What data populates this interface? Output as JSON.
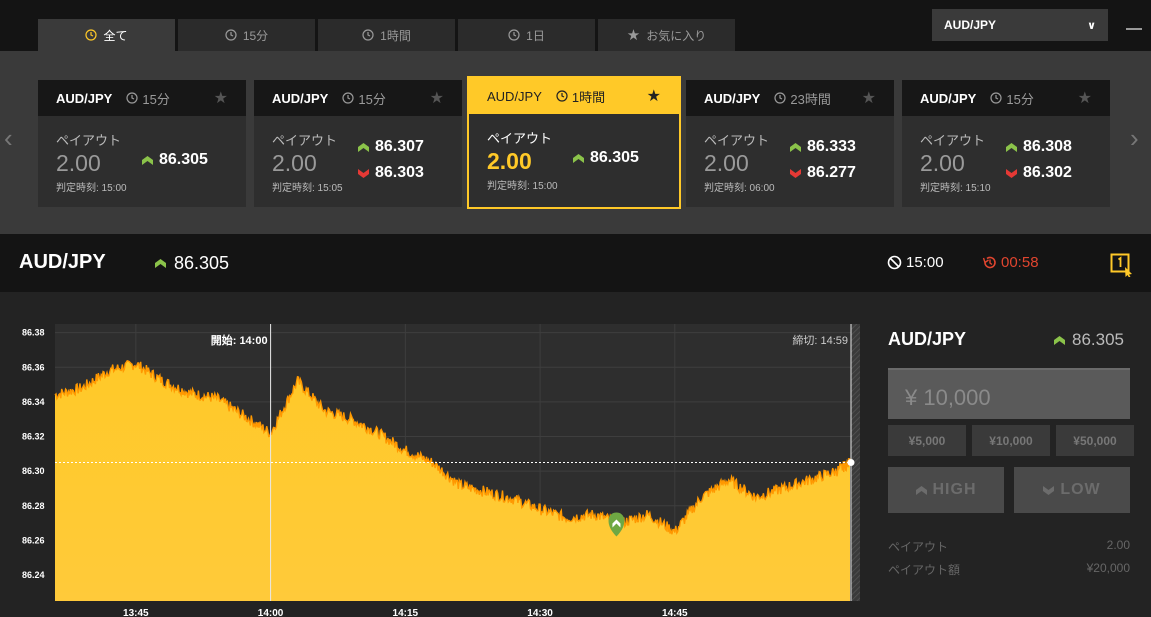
{
  "tabs": [
    {
      "label": "全て",
      "active": true
    },
    {
      "label": "15分",
      "active": false
    },
    {
      "label": "1時間",
      "active": false
    },
    {
      "label": "1日",
      "active": false
    },
    {
      "label": "お気に入り",
      "active": false,
      "icon": "star-icon"
    }
  ],
  "pair_select": {
    "value": "AUD/JPY"
  },
  "cards": [
    {
      "symbol": "AUD/JPY",
      "period": "15分",
      "payout_label": "ペイアウト",
      "payout": "2.00",
      "up": "86.305",
      "down": null,
      "judge": "判定時刻: 15:00",
      "selected": false
    },
    {
      "symbol": "AUD/JPY",
      "period": "15分",
      "payout_label": "ペイアウト",
      "payout": "2.00",
      "up": "86.307",
      "down": "86.303",
      "judge": "判定時刻: 15:05",
      "selected": false
    },
    {
      "symbol": "AUD/JPY",
      "period": "1時間",
      "payout_label": "ペイアウト",
      "payout": "2.00",
      "up": "86.305",
      "down": null,
      "judge": "判定時刻: 15:00",
      "selected": true
    },
    {
      "symbol": "AUD/JPY",
      "period": "23時間",
      "payout_label": "ペイアウト",
      "payout": "2.00",
      "up": "86.333",
      "down": "86.277",
      "judge": "判定時刻: 06:00",
      "selected": false
    },
    {
      "symbol": "AUD/JPY",
      "period": "15分",
      "payout_label": "ペイアウト",
      "payout": "2.00",
      "up": "86.308",
      "down": "86.302",
      "judge": "判定時刻: 15:10",
      "selected": false
    }
  ],
  "symbar": {
    "symbol": "AUD/JPY",
    "rate": "86.305",
    "close_time": "15:00",
    "countdown": "00:58"
  },
  "chart": {
    "start_label": "開始: 14:00",
    "end_label": "締切: 14:59",
    "y_ticks": [
      "86.38",
      "86.36",
      "86.34",
      "86.32",
      "86.30",
      "86.28",
      "86.26",
      "86.24"
    ],
    "x_ticks": [
      "13:45",
      "14:00",
      "14:15",
      "14:30",
      "14:45"
    ],
    "colors": {
      "fill": "#ffc928",
      "line": "#ff9800",
      "bg": "#2e2e2e"
    }
  },
  "chart_data": {
    "type": "area",
    "ylim": [
      86.225,
      86.385
    ],
    "x_minutes": [
      0,
      3,
      6,
      9,
      12,
      15,
      18,
      21,
      24,
      27,
      30,
      33,
      36,
      39,
      42,
      45,
      48,
      51,
      54,
      57,
      60,
      63,
      66,
      69,
      72,
      75,
      78,
      81,
      84,
      87,
      88.5
    ],
    "values": [
      86.344,
      86.348,
      86.358,
      86.362,
      86.352,
      86.345,
      86.342,
      86.332,
      86.322,
      86.352,
      86.335,
      86.33,
      86.322,
      86.312,
      86.305,
      86.292,
      86.288,
      86.284,
      86.278,
      86.273,
      86.275,
      86.27,
      86.275,
      86.265,
      86.285,
      86.295,
      86.285,
      86.29,
      86.295,
      86.3,
      86.305
    ],
    "current": 86.305
  },
  "panel": {
    "symbol": "AUD/JPY",
    "rate": "86.305",
    "amount": "¥ 10,000",
    "presets": [
      "¥5,000",
      "¥10,000",
      "¥50,000"
    ],
    "high_label": "HIGH",
    "low_label": "LOW",
    "payout_label": "ペイアウト",
    "payout_value": "2.00",
    "payout_amount_label": "ペイアウト額",
    "payout_amount_value": "¥20,000"
  }
}
